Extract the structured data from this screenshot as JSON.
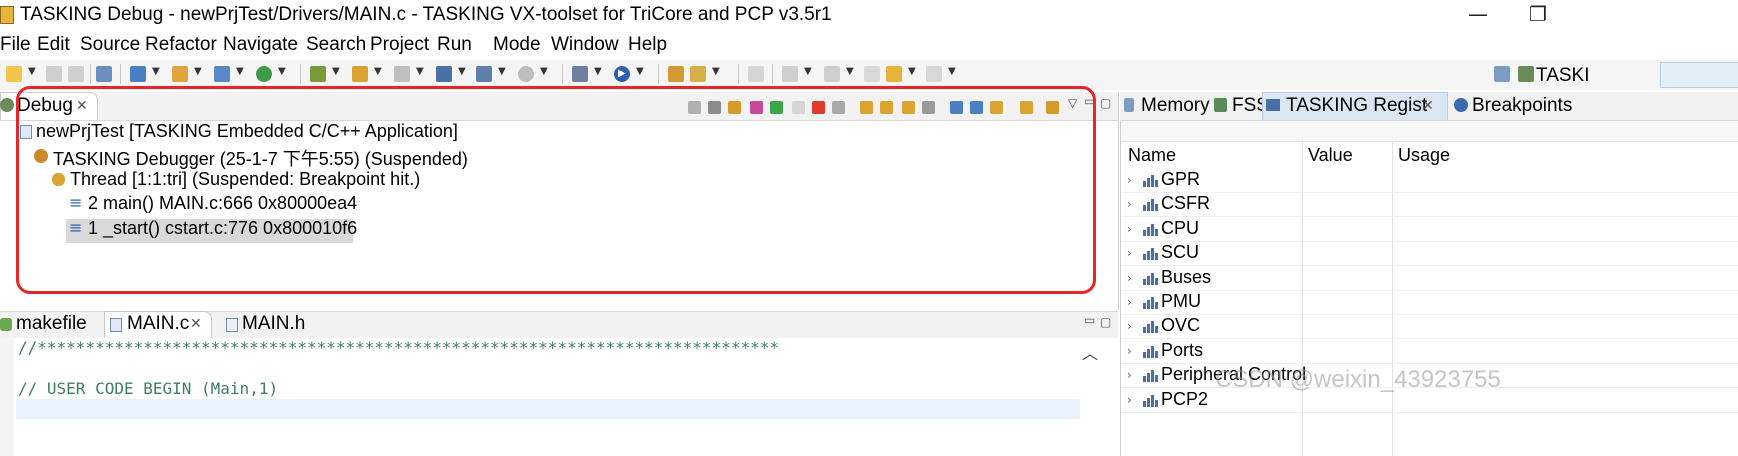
{
  "window": {
    "title": "TASKING Debug - newPrjTest/Drivers/MAIN.c - TASKING VX-toolset for TriCore and PCP v3.5r1",
    "minimize_glyph": "—",
    "restore_glyph": "❐"
  },
  "menu": [
    "File",
    "Edit",
    "Source",
    "Refactor",
    "Navigate",
    "Search",
    "Project",
    "Run",
    "Mode",
    "Window",
    "Help"
  ],
  "perspective": {
    "label": "TASKI",
    "icon": "debug-perspective-icon"
  },
  "debug_view": {
    "tab_label": "Debug",
    "tree": {
      "launch": "newPrjTest [TASKING Embedded C/C++ Application]",
      "debugger": "TASKING Debugger (25-1-7 下午5:55) (Suspended)",
      "thread": "Thread [1:1:tri] (Suspended: Breakpoint hit.)",
      "frames": [
        {
          "label": "2 main() MAIN.c:666 0x80000ea4",
          "selected": true
        },
        {
          "label": "1 _start() cstart.c:776 0x800010f6",
          "selected": false
        }
      ]
    },
    "highlight_color": "#e8262a"
  },
  "editor": {
    "tabs": [
      {
        "label": "makefile",
        "active": false
      },
      {
        "label": "MAIN.c",
        "active": true
      },
      {
        "label": "MAIN.h",
        "active": false
      }
    ],
    "lines": [
      "//*****************************************************************************",
      "",
      "// USER CODE BEGIN (Main,1)"
    ],
    "comment_color": "#3f7f5f"
  },
  "right_view": {
    "tabs": [
      {
        "label": "Memory",
        "active": false
      },
      {
        "label": "FSS",
        "active": false
      },
      {
        "label": "TASKING Regist",
        "active": true
      },
      {
        "label": "Breakpoints",
        "active": false
      }
    ],
    "columns": [
      "Name",
      "Value",
      "Usage"
    ],
    "registers": [
      "GPR",
      "CSFR",
      "CPU",
      "SCU",
      "Buses",
      "PMU",
      "OVC",
      "Ports",
      "Peripheral Control",
      "PCP2"
    ]
  },
  "watermark": "CSDN @weixin_43923755"
}
